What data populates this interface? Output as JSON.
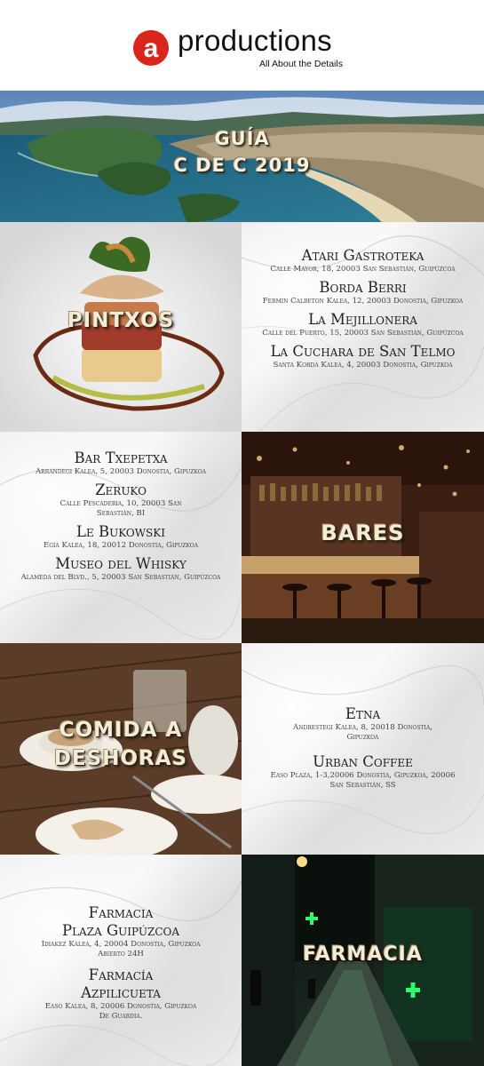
{
  "brand": {
    "logo_letter": "a",
    "name": "productions",
    "tagline": "All About the Details",
    "accent_color": "#d9261c"
  },
  "hero": {
    "title_line1": "GUÍA",
    "title_line2": "C DE C 2019"
  },
  "sections": {
    "pintxos": {
      "label": "PINTXOS",
      "entries": [
        {
          "name": "Atari Gastroteka",
          "address": "Calle Mayor, 18, 20003 San Sebastián, Guipúzcoa"
        },
        {
          "name": "Borda Berri",
          "address": "Fermin Calbeton Kalea, 12, 20003 Donostia, Gipuzkoa"
        },
        {
          "name": "La Mejillonera",
          "address": "Calle del Puerto, 15, 20003 San Sebastián, Guipúzcoa"
        },
        {
          "name": "La Cuchara de San Telmo",
          "address": "Santa Korda Kalea, 4, 20003 Donostia, Gipuzkoa"
        }
      ]
    },
    "bares": {
      "label": "BARES",
      "entries": [
        {
          "name": "Bar Txepetxa",
          "address": "Arrandegi Kalea, 5, 20003 Donostia, Gipuzkoa"
        },
        {
          "name": "Zeruko",
          "address": "Calle Pescaderia, 10, 20003 San Sebastián, BI"
        },
        {
          "name": "Le Bukowski",
          "address": "Egia Kalea, 18, 20012 Donostia, Gipuzkoa"
        },
        {
          "name": "Museo del Whisky",
          "address": "Alameda del Blvd., 5, 20003 San Sebastián, Guipúzcoa"
        }
      ]
    },
    "comida": {
      "label_line1": "COMIDA A",
      "label_line2": "DESHORAS",
      "entries": [
        {
          "name": "Etna",
          "address": "Andrestegi Kalea, 8, 20018 Donostia, Gipuzkoa"
        },
        {
          "name": "Urban Coffee",
          "address": "Easo Plaza, 1-3,20006 Donostia, Gipuzkoa, 20006 San Sebastián, SS"
        }
      ]
    },
    "farmacia": {
      "label": "FARMACIA",
      "entries": [
        {
          "name_line1": "Farmacia",
          "name_line2": "Plaza Guipúzcoa",
          "address": "Idiakez Kalea, 4, 20004 Donostia, Gipuzkoa",
          "extra": "Abierto 24H"
        },
        {
          "name_line1": "Farmacía",
          "name_line2": "Azpilicueta",
          "address": "Easo Kalea, 8, 20006 Donostia, Gipuzkoa",
          "extra": "De Guardia."
        }
      ]
    }
  }
}
